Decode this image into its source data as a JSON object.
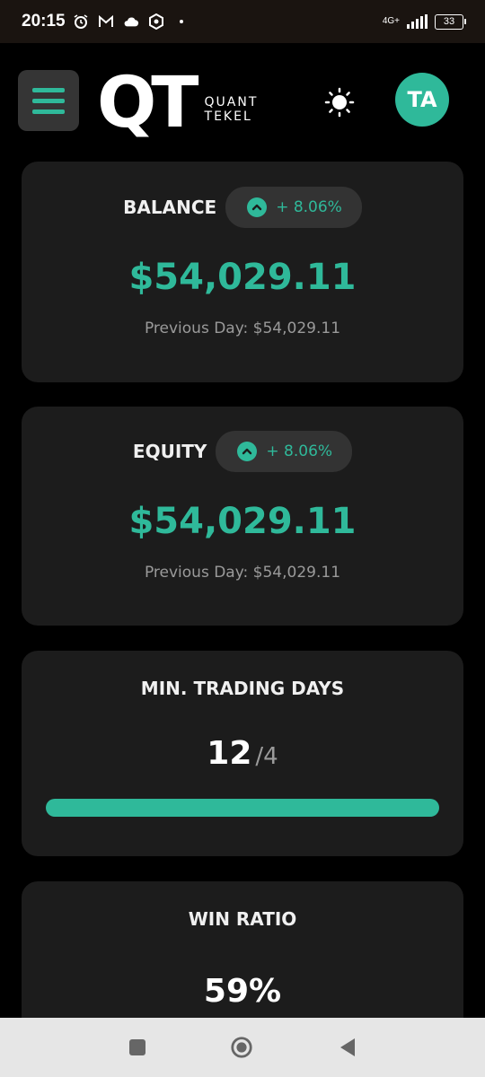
{
  "status_bar": {
    "time": "20:15",
    "network_type": "4G+",
    "battery_level": "33"
  },
  "header": {
    "logo_mark": "QT",
    "logo_line1": "QUANT",
    "logo_line2": "TEKEL",
    "avatar_initials": "TA"
  },
  "cards": {
    "balance": {
      "title": "BALANCE",
      "change": "+ 8.06%",
      "value": "$54,029.11",
      "previous": "Previous Day: $54,029.11"
    },
    "equity": {
      "title": "EQUITY",
      "change": "+ 8.06%",
      "value": "$54,029.11",
      "previous": "Previous Day: $54,029.11"
    },
    "min_trading_days": {
      "title": "MIN. TRADING DAYS",
      "value": "12",
      "target": "/4",
      "progress_fraction": 1.0
    },
    "win_ratio": {
      "title": "WIN RATIO",
      "value": "59%"
    }
  },
  "colors": {
    "accent": "#2fb99a",
    "card_bg": "#1c1c1c",
    "page_bg": "#000000"
  }
}
